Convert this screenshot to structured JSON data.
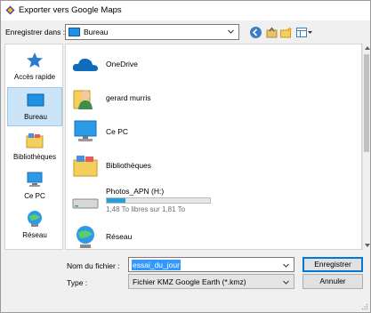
{
  "window": {
    "title": "Exporter vers Google Maps"
  },
  "save_in": {
    "label": "Enregistrer dans :",
    "value": "Bureau"
  },
  "places": [
    {
      "label": "Accès rapide",
      "icon": "star-icon"
    },
    {
      "label": "Bureau",
      "icon": "desktop-icon",
      "selected": true
    },
    {
      "label": "Bibliothèques",
      "icon": "libraries-icon"
    },
    {
      "label": "Ce PC",
      "icon": "computer-icon"
    },
    {
      "label": "Réseau",
      "icon": "network-icon"
    }
  ],
  "files": [
    {
      "name": "OneDrive",
      "icon": "onedrive-icon"
    },
    {
      "name": "gerard murris",
      "icon": "user-folder-icon"
    },
    {
      "name": "Ce PC",
      "icon": "computer-icon"
    },
    {
      "name": "Bibliothèques",
      "icon": "libraries-icon"
    },
    {
      "name": "Photos_APN (H:)",
      "icon": "drive-icon",
      "free_text": "1,48 To libres sur 1,81 To",
      "used_fraction": 0.18
    },
    {
      "name": "Réseau",
      "icon": "network-icon"
    }
  ],
  "filename": {
    "label": "Nom du fichier :",
    "value": "essai_du_jour"
  },
  "filetype": {
    "label": "Type :",
    "value": "Fichier KMZ Google Earth (*.kmz)"
  },
  "buttons": {
    "save": "Enregistrer",
    "cancel": "Annuler"
  },
  "colors": {
    "accent": "#0078d7",
    "selection": "#cce4f7",
    "text_selection": "#3399ff",
    "drive_bar": "#26a0da"
  }
}
